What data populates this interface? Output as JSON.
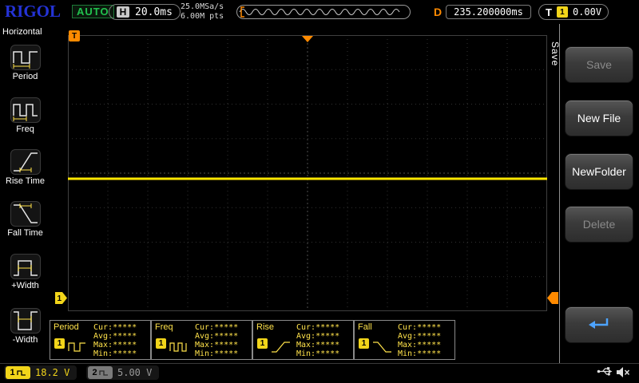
{
  "top_bar": {
    "logo": "RIGOL",
    "run_status": "AUTO",
    "horizontal": {
      "label": "H",
      "timebase": "20.0ms"
    },
    "acquisition": {
      "sample_rate": "25.0MSa/s",
      "memory_depth": "6.00M pts"
    },
    "delay": {
      "label": "D",
      "value": "235.200000ms"
    },
    "trigger": {
      "label": "T",
      "channel": "1",
      "level": "0.00V"
    }
  },
  "sidebar": {
    "title": "Horizontal",
    "items": [
      {
        "label": "Period",
        "icon": "period-icon"
      },
      {
        "label": "Freq",
        "icon": "freq-icon"
      },
      {
        "label": "Rise Time",
        "icon": "rise-time-icon"
      },
      {
        "label": "Fall Time",
        "icon": "fall-time-icon"
      },
      {
        "label": "+Width",
        "icon": "plus-width-icon"
      },
      {
        "label": "-Width",
        "icon": "minus-width-icon"
      }
    ]
  },
  "graticule": {
    "columns": 12,
    "rows": 8,
    "trace": {
      "channel": "1",
      "color": "#ffe600",
      "shape": "flat-horizontal-line",
      "y_fraction": 0.52
    },
    "trigger_position_fraction": 0.5,
    "corner_marker": "T",
    "left_marker_channel": "1"
  },
  "menu": {
    "tab_label": "Save",
    "buttons": [
      {
        "label": "Save",
        "enabled": false
      },
      {
        "label": "New File",
        "enabled": true
      },
      {
        "label": "NewFolder",
        "enabled": true
      },
      {
        "label": "Delete",
        "enabled": false
      }
    ],
    "back_icon": "return-arrow-icon",
    "accent_color": "#4da3ff"
  },
  "measurements": [
    {
      "name": "Period",
      "channel": "1",
      "icon": "period-wave-icon",
      "rows": [
        "Cur:*****",
        "Avg:*****",
        "Max:*****",
        "Min:*****"
      ]
    },
    {
      "name": "Freq",
      "channel": "1",
      "icon": "freq-wave-icon",
      "rows": [
        "Cur:*****",
        "Avg:*****",
        "Max:*****",
        "Min:*****"
      ]
    },
    {
      "name": "Rise",
      "channel": "1",
      "icon": "rise-edge-icon",
      "rows": [
        "Cur:*****",
        "Avg:*****",
        "Max:*****",
        "Min:*****"
      ]
    },
    {
      "name": "Fall",
      "channel": "1",
      "icon": "fall-edge-icon",
      "rows": [
        "Cur:*****",
        "Avg:*****",
        "Max:*****",
        "Min:*****"
      ]
    }
  ],
  "status_bar": {
    "channels": [
      {
        "number": "1",
        "value": "18.2 V",
        "color": "#f2d51a",
        "active": true
      },
      {
        "number": "2",
        "value": "5.00 V",
        "color": "#8a8a8a",
        "active": false
      }
    ],
    "icons": [
      "usb-icon",
      "speaker-muted-icon"
    ]
  },
  "colors": {
    "ch1_yellow": "#f2d51a",
    "ch2_gray": "#8a8a8a",
    "trigger_orange": "#ff8a00",
    "logo_blue": "#2433d6",
    "auto_green": "#21c24e"
  }
}
